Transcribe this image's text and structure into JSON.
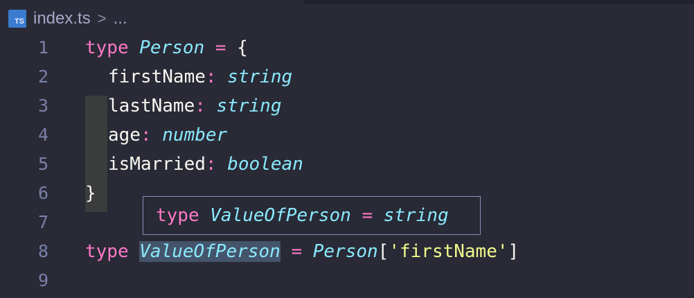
{
  "breadcrumb": {
    "file_icon": "typescript-file-icon",
    "file_icon_text": "TS",
    "filename": "index.ts",
    "separator": ">",
    "more": "..."
  },
  "editor": {
    "lines": [
      {
        "number": "1",
        "tokens": [
          "type",
          " ",
          "Person",
          " ",
          "=",
          " ",
          "{"
        ]
      },
      {
        "number": "2",
        "tokens": [
          "firstName",
          ":",
          " ",
          "string"
        ]
      },
      {
        "number": "3",
        "tokens": [
          "lastName",
          ":",
          " ",
          "string"
        ]
      },
      {
        "number": "4",
        "tokens": [
          "age",
          ":",
          " ",
          "number"
        ]
      },
      {
        "number": "5",
        "tokens": [
          "isMarried",
          ":",
          " ",
          "boolean"
        ]
      },
      {
        "number": "6",
        "tokens": [
          "}"
        ]
      },
      {
        "number": "7",
        "tokens": []
      },
      {
        "number": "8",
        "tokens": [
          "type",
          " ",
          "ValueOfPerson",
          " ",
          "=",
          " ",
          "Person",
          "[",
          "'firstName'",
          "]"
        ]
      },
      {
        "number": "9",
        "tokens": []
      }
    ]
  },
  "hover": {
    "keyword": "type",
    "name": "ValueOfPerson",
    "operator": "=",
    "value": "string"
  },
  "colors": {
    "background": "#292a36",
    "keyword": "#ff79c6",
    "type": "#8be9fd",
    "string": "#f1fa8c",
    "line_number": "#7b7fa8"
  }
}
